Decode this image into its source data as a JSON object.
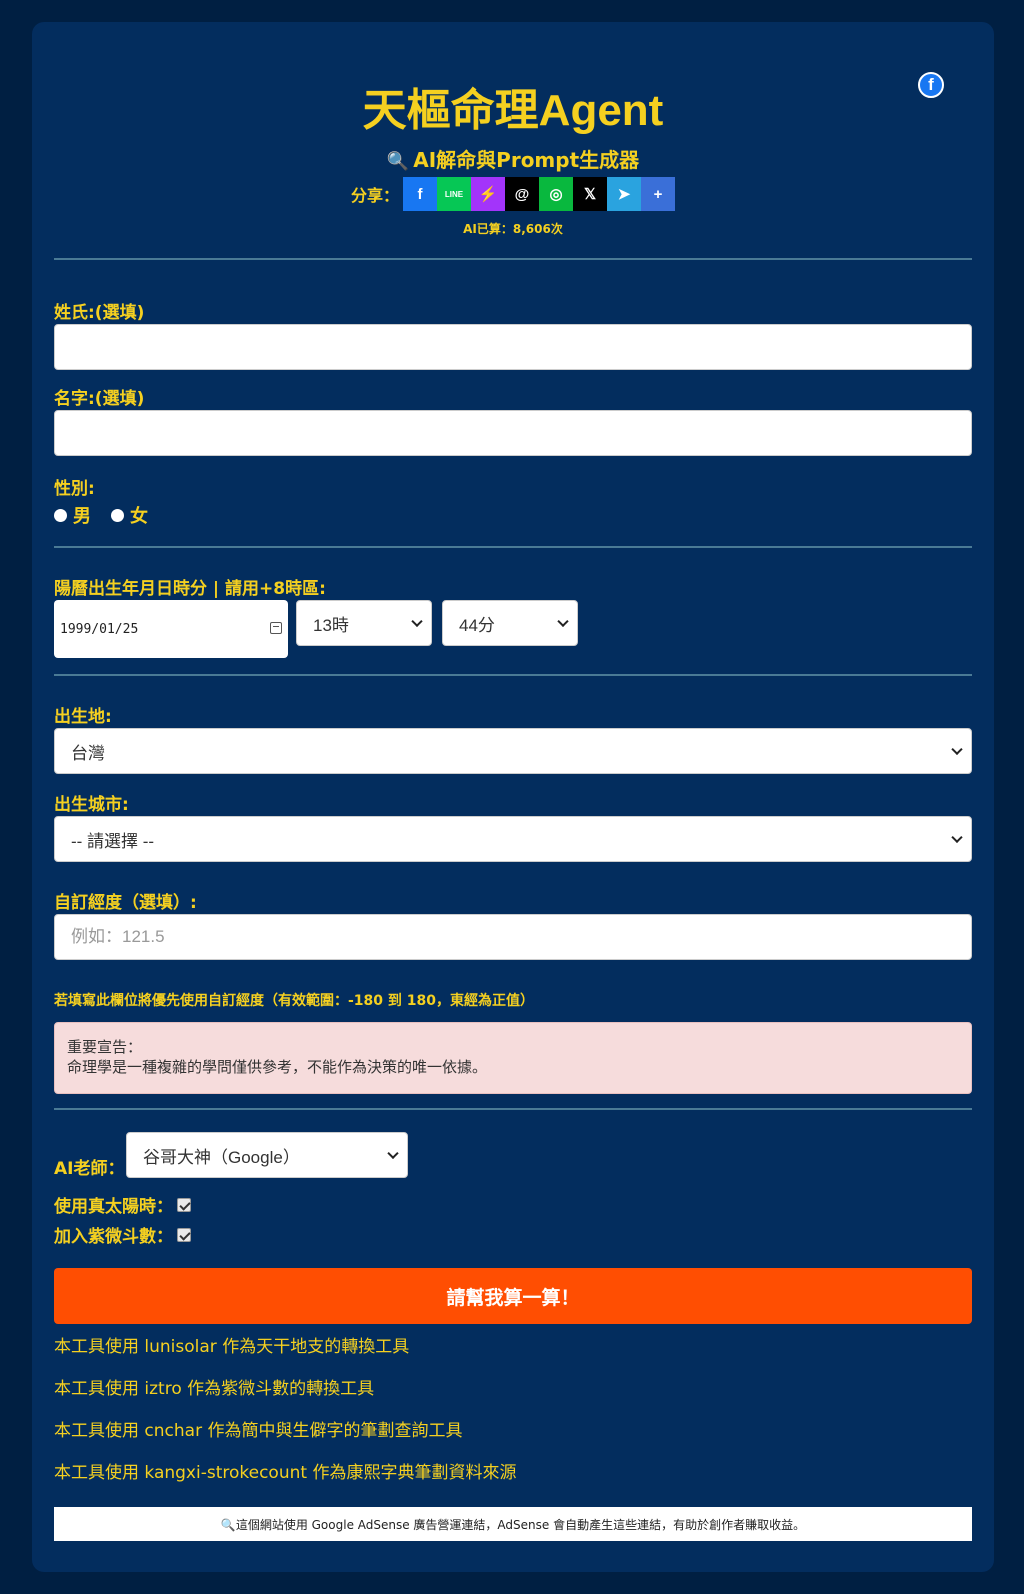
{
  "header": {
    "title": "天樞命理Agent",
    "subtitle": "AI解命與Prompt生成器",
    "share_label": "分享：",
    "share_icons": [
      {
        "name": "facebook-icon",
        "glyph": "f",
        "bg": "#1877f2"
      },
      {
        "name": "line-icon",
        "glyph": "LINE",
        "bg": "#06c755"
      },
      {
        "name": "messenger-icon",
        "glyph": "⚡",
        "bg": "#a334fa"
      },
      {
        "name": "threads-icon",
        "glyph": "@",
        "bg": "#000000"
      },
      {
        "name": "wechat-icon",
        "glyph": "◎",
        "bg": "#09b83e"
      },
      {
        "name": "x-icon",
        "glyph": "𝕏",
        "bg": "#000000"
      },
      {
        "name": "telegram-icon",
        "glyph": "➤",
        "bg": "#2aa3df"
      },
      {
        "name": "more-share-icon",
        "glyph": "+",
        "bg": "#3a6fd8"
      }
    ],
    "ai_count": "AI已算：8,606次"
  },
  "form": {
    "surname_label": "姓氏:(選填)",
    "surname_value": "",
    "given_name_label": "名字:(選填)",
    "given_name_value": "",
    "gender_label": "性別:",
    "gender_options": [
      "男",
      "女"
    ],
    "birth_label": "陽曆出生年月日時分 | 請用+8時區:",
    "birth_date": "1999/01/25",
    "birth_hour": "13時",
    "birth_minute": "44分",
    "birthplace_label": "出生地:",
    "birthplace_value": "台灣",
    "city_label": "出生城市:",
    "city_value": "-- 請選擇 --",
    "longitude_label": "自訂經度（選填）:",
    "longitude_placeholder": "例如：121.5",
    "longitude_hint": "若填寫此欄位將優先使用自訂經度（有效範圍：-180 到 180，東經為正值）",
    "warning_title": "重要宣告：",
    "warning_text": "命理學是一種複雜的學問僅供參考，不能作為決策的唯一依據。",
    "ai_teacher_label": "AI老師：",
    "ai_teacher_value": "谷哥大神（Google）",
    "true_solar_label": "使用真太陽時：",
    "ziwei_label": "加入紫微斗數：",
    "submit_label": "請幫我算一算！"
  },
  "credits": [
    "本工具使用 lunisolar 作為天干地支的轉換工具",
    "本工具使用 iztro 作為紫微斗數的轉換工具",
    "本工具使用 cnchar 作為簡中與生僻字的筆劃查詢工具",
    "本工具使用 kangxi-strokecount 作為康熙字典筆劃資料來源"
  ],
  "footer": {
    "text": "🔍這個網站使用 Google AdSense 廣告營運連結，AdSense 會自動產生這些連結，有助於創作者賺取收益。"
  },
  "colors": {
    "background": "#001f42",
    "card": "#032d5e",
    "accent": "#f5d020",
    "submit": "#ff4e02"
  }
}
